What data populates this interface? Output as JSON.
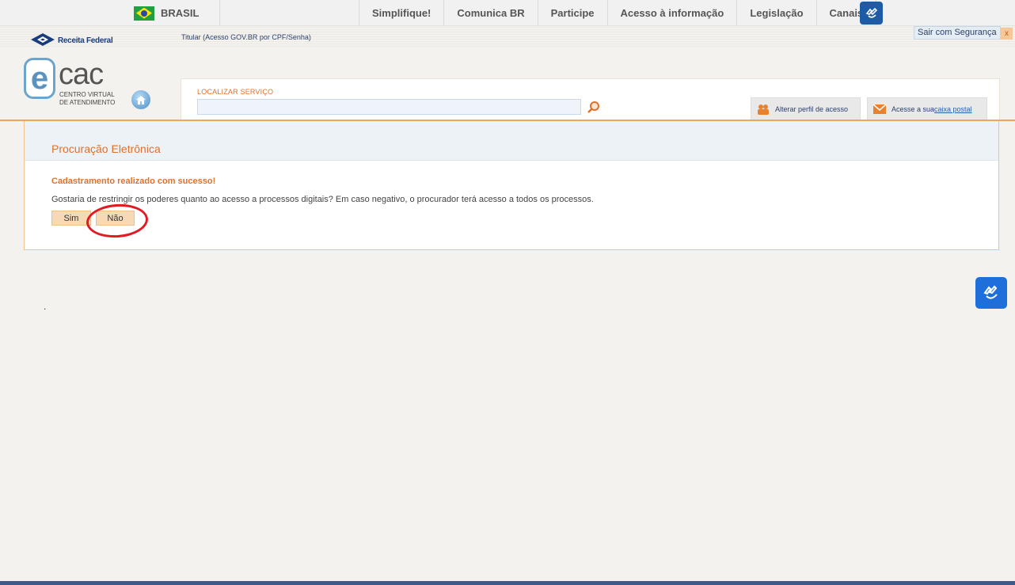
{
  "govbar": {
    "country": "BRASIL",
    "links": [
      "Simplifique!",
      "Comunica BR",
      "Participe",
      "Acesso à informação",
      "Legislação",
      "Canais"
    ],
    "accessibility_icon": "sign-language-icon"
  },
  "header": {
    "brand": "Receita Federal",
    "user_info": "Titular (Acesso GOV.BR por CPF/Senha)",
    "logout": "Sair com Segurança",
    "logout_close": "x",
    "logo_main": "cac",
    "logo_e": "e",
    "logo_sub_line1": "CENTRO VIRTUAL",
    "logo_sub_line2": "DE ATENDIMENTO"
  },
  "search": {
    "label": "LOCALIZAR SERVIÇO",
    "value": "",
    "icon": "search-icon"
  },
  "tabs": {
    "perfil": "Alterar perfil de acesso",
    "caixa_prefix": "Acesse a sua ",
    "caixa_link": "caixa postal"
  },
  "content": {
    "title": "Procuração Eletrônica",
    "success": "Cadastramento realizado com sucesso!",
    "question": "Gostaria de restringir os poderes quanto ao acesso a processos digitais? Em caso negativo, o procurador terá acesso a todos os processos.",
    "btn_yes": "Sim",
    "btn_no": "Não"
  },
  "misc": {
    "dot": "."
  },
  "colors": {
    "accent": "#e0712a",
    "highlight": "#e01b24",
    "button_bg": "#f8d9b5",
    "footer": "#3d5a8a"
  }
}
